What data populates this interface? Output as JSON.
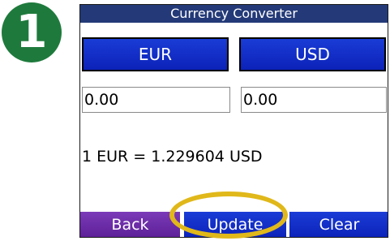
{
  "step": {
    "number": "1",
    "color": "#1e7a3c"
  },
  "window": {
    "title": "Currency Converter"
  },
  "currencies": {
    "from": "EUR",
    "to": "USD"
  },
  "amounts": {
    "from": "0.00",
    "to": "0.00"
  },
  "rate_text": "1 EUR = 1.229604 USD",
  "buttons": {
    "back": "Back",
    "update": "Update",
    "clear": "Clear"
  },
  "colors": {
    "title_bar": "#243a78",
    "button_blue": "#1a3cd6",
    "back_purple": "#7b3ab8",
    "highlight": "#e0b81a"
  }
}
